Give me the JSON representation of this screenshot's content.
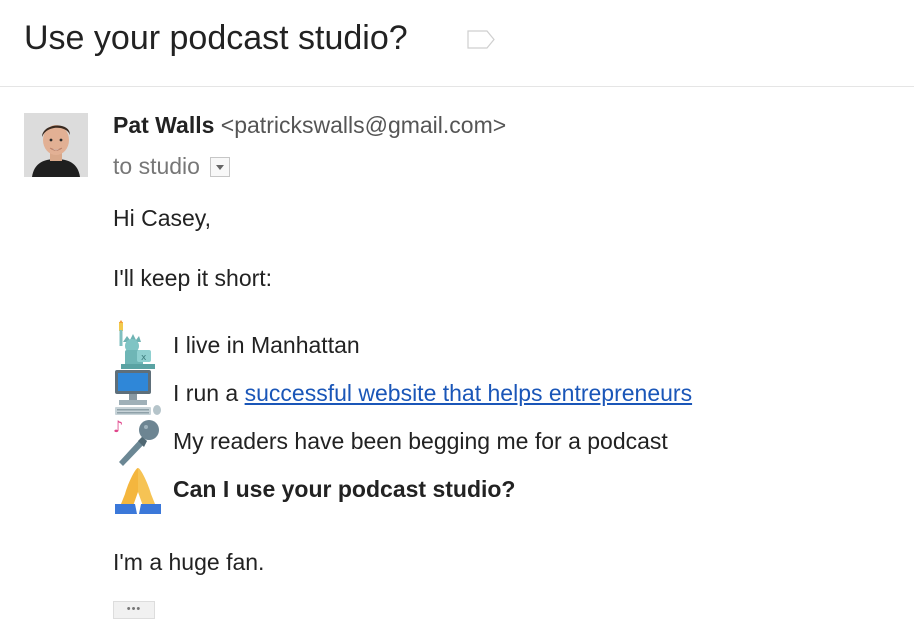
{
  "subject": "Use your podcast studio?",
  "sender": {
    "name": "Pat Walls",
    "email": "<patrickswalls@gmail.com>"
  },
  "recipient": "to studio",
  "body": {
    "greeting": "Hi Casey,",
    "intro": "I'll keep it short:",
    "bullets": [
      {
        "icon": "statue-of-liberty-icon",
        "text": "I live in Manhattan"
      },
      {
        "icon": "desktop-computer-icon",
        "prefix": "I run a ",
        "link": "successful website that helps entrepreneurs"
      },
      {
        "icon": "microphone-icon",
        "text": "My readers have been begging me for a podcast"
      },
      {
        "icon": "folded-hands-icon",
        "text": "Can I use your podcast studio?"
      }
    ],
    "closing": "I'm a huge fan."
  },
  "trimmed_content_label": "•••",
  "colors": {
    "link": "#1a56b8",
    "sender_name": "#222222",
    "recipient": "#777777",
    "divider": "#e5e5e5"
  }
}
